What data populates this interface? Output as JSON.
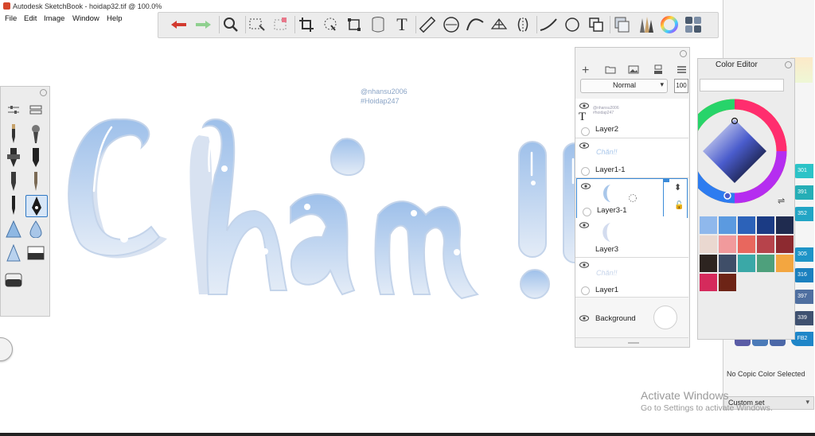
{
  "window": {
    "title": "Autodesk SketchBook - hoidap32.tif @ 100.0%",
    "controls": {
      "minimize": "—",
      "maximize": "❐",
      "close": "✕"
    }
  },
  "menu": [
    "File",
    "Edit",
    "Image",
    "Window",
    "Help"
  ],
  "toolbar": {
    "tools": [
      "undo-icon",
      "redo-icon",
      "zoom-icon",
      "select-icon",
      "quick-select-icon",
      "crop-icon",
      "lasso-icon",
      "transform-icon",
      "fill-icon",
      "text-icon",
      "ruler-icon",
      "ellipse-guide-icon",
      "curve-guide-icon",
      "perspective-icon",
      "symmetry-icon",
      "stroke-icon",
      "circle-icon",
      "copy-paste-icon",
      "layers-toggle-icon",
      "brush-library-icon",
      "color-wheel-icon",
      "puck-icon"
    ]
  },
  "canvas": {
    "watermark_line1": "@nhansu2006",
    "watermark_line2": "#Hoidap247",
    "artwork_text": "Chăn!!",
    "colors": {
      "letter_fill": "#a9c7ea",
      "letter_shadow": "#cfdcef",
      "highlight": "#ffffff"
    }
  },
  "layers_panel": {
    "blend_mode": "Normal",
    "opacity": "100",
    "layers": [
      {
        "name": "Layer2",
        "thumb_text": "@nhansu2006 #hoidap247",
        "type": "text"
      },
      {
        "name": "Layer1-1",
        "thumb_text": "Chăn!!",
        "type": "image"
      },
      {
        "name": "Layer3-1",
        "thumb_text": "",
        "type": "image"
      },
      {
        "name": "Layer3",
        "thumb_text": "",
        "type": "image"
      },
      {
        "name": "Layer1",
        "thumb_text": "Chăn!!",
        "type": "image"
      },
      {
        "name": "Background",
        "thumb_text": "",
        "type": "background"
      }
    ]
  },
  "color_editor": {
    "title": "Color Editor",
    "swatches": [
      "#8fb8ec",
      "#5b9ae0",
      "#2c62b9",
      "#1b3b84",
      "#1f2b4f",
      "#ead8d0",
      "#f19a9c",
      "#e8675e",
      "#b7434b",
      "#8d2a30",
      "#2d2420",
      "#3f4e68",
      "#3aa8a7",
      "#4ea07c",
      "#f3a640",
      "#d52a5c",
      "#6d2416"
    ]
  },
  "copic": {
    "tabs": [
      "301",
      "391",
      "352",
      "305",
      "316",
      "397",
      "339",
      "FB2"
    ],
    "message": "No Copic Color Selected",
    "set": "Custom set"
  },
  "os_notice": {
    "line1": "Activate Windows",
    "line2": "Go to Settings to activate Windows."
  }
}
